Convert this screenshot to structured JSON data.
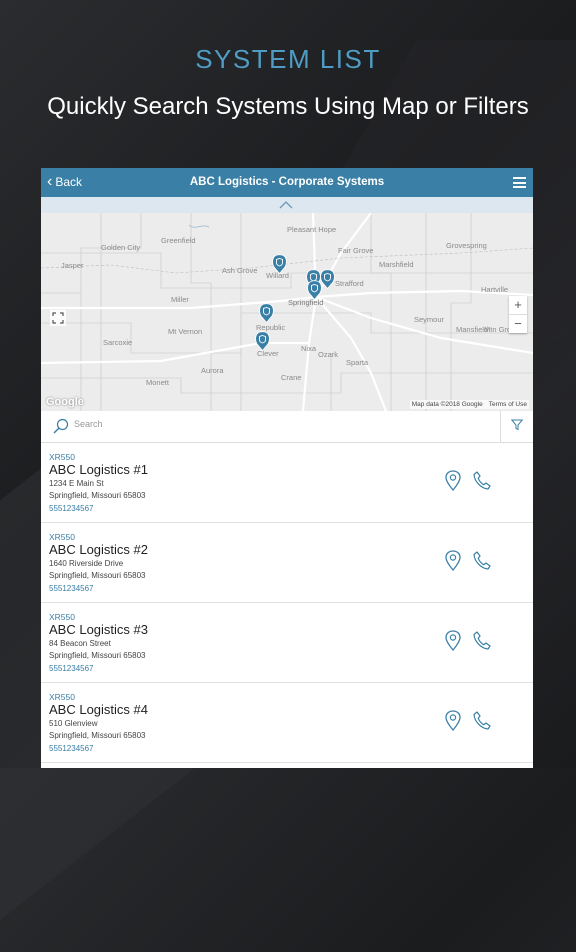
{
  "promo": {
    "headline": "SYSTEM LIST",
    "subline": "Quickly Search Systems Using Map or Filters"
  },
  "navbar": {
    "back_label": "Back",
    "title": "ABC Logistics - Corporate Systems"
  },
  "map": {
    "towns": [
      "Golden City",
      "Greenfield",
      "Pleasant Hope",
      "Fair Grove",
      "Grovespring",
      "Jasper",
      "Ash Grove",
      "Willard",
      "Strafford",
      "Marshfield",
      "Hartville",
      "Miller",
      "Springfield",
      "Seymour",
      "Republic",
      "Mt Vernon",
      "Sarcoxie",
      "Nixa",
      "Ozark",
      "Mansfield",
      "Mtn Grove",
      "Clever",
      "Sparta",
      "Monett",
      "Aurora",
      "Crane"
    ],
    "attribution": "Google",
    "map_data": "Map data ©2018 Google",
    "terms": "Terms of Use",
    "zoom_in": "+",
    "zoom_out": "−",
    "pin_color": "#3a7fa5"
  },
  "search": {
    "placeholder": "Search"
  },
  "systems": [
    {
      "model": "XR550",
      "name": "ABC Logistics #1",
      "address1": "1234 E Main St",
      "address2": "Springfield, Missouri 65803",
      "phone": "5551234567"
    },
    {
      "model": "XR550",
      "name": "ABC Logistics #2",
      "address1": "1640 Riverside Drive",
      "address2": "Springfield, Missouri 65803",
      "phone": "5551234567"
    },
    {
      "model": "XR550",
      "name": "ABC Logistics #3",
      "address1": "84 Beacon Street",
      "address2": "Springfield, Missouri 65803",
      "phone": "5551234567"
    },
    {
      "model": "XR550",
      "name": "ABC Logistics #4",
      "address1": "510 Glenview",
      "address2": "Springfield, Missouri 65803",
      "phone": "5551234567"
    }
  ],
  "colors": {
    "accent": "#3a7fa5",
    "headline": "#4f9cc4"
  }
}
